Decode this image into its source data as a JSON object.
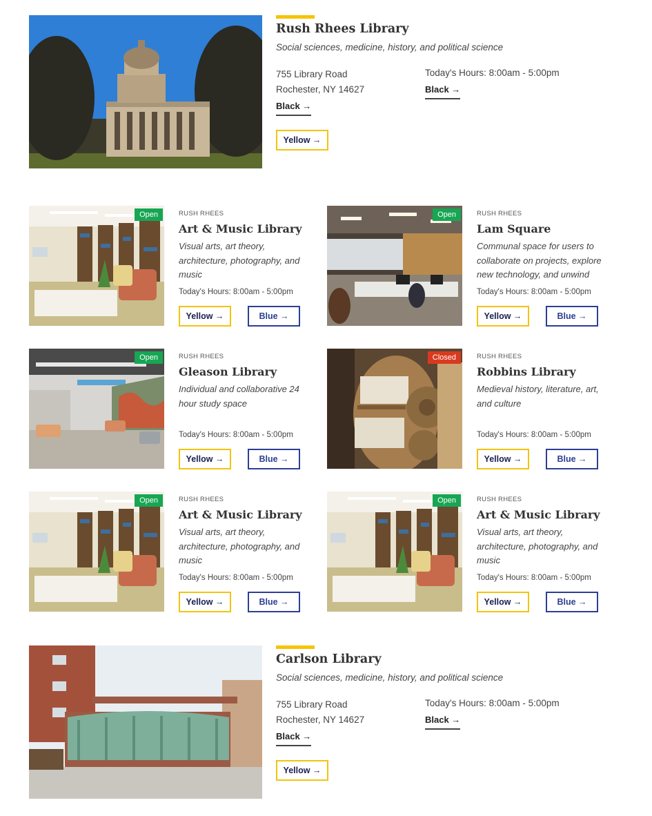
{
  "featured": [
    {
      "title": "Rush Rhees Library",
      "subtitle": "Social sciences, medicine, history, and political science",
      "address_line1": "755 Library Road",
      "address_line2": "Rochester, NY 14627",
      "hours": "Today's Hours: 8:00am - 5:00pm",
      "link1": "Black →",
      "link2": "Black →",
      "button": "Yellow →",
      "image": "rush-rhees-building-photo"
    },
    {
      "title": "Carlson Library",
      "subtitle": "Social sciences, medicine, history, and political science",
      "address_line1": "755 Library Road",
      "address_line2": "Rochester, NY 14627",
      "hours": "Today's Hours: 8:00am - 5:00pm",
      "link1": "Black →",
      "link2": "Black →",
      "button": "Yellow →",
      "image": "carlson-building-photo"
    }
  ],
  "cards": [
    {
      "eyebrow": "RUSH RHEES",
      "title": "Art & Music Library",
      "description": "Visual arts, art theory, architecture, photography, and music",
      "hours": "Today's Hours: 8:00am - 5:00pm",
      "status": "Open",
      "yellow": "Yellow →",
      "blue": "Blue →",
      "image": "library-lounge-photo"
    },
    {
      "eyebrow": "RUSH RHEES",
      "title": "Lam Square",
      "description": "Communal space for users to collaborate on projects, explore new technology, and unwind",
      "hours": "Today's Hours: 8:00am - 5:00pm",
      "status": "Open",
      "yellow": "Yellow →",
      "blue": "Blue →",
      "image": "lam-square-photo"
    },
    {
      "eyebrow": "RUSH RHEES",
      "title": "Gleason Library",
      "description": "Individual and collaborative 24 hour study space",
      "hours": "Today's Hours: 8:00am - 5:00pm",
      "status": "Open",
      "yellow": "Yellow →",
      "blue": "Blue →",
      "image": "gleason-study-space-photo"
    },
    {
      "eyebrow": "RUSH RHEES",
      "title": "Robbins Library",
      "description": "Medieval history, literature, art, and culture",
      "hours": "Today's Hours: 8:00am - 5:00pm",
      "status": "Closed",
      "yellow": "Yellow →",
      "blue": "Blue →",
      "image": "robbins-wheel-shelf-photo"
    },
    {
      "eyebrow": "RUSH RHEES",
      "title": "Art & Music Library",
      "description": "Visual arts, art theory, architecture, photography, and music",
      "hours": "Today's Hours: 8:00am - 5:00pm",
      "status": "Open",
      "yellow": "Yellow →",
      "blue": "Blue →",
      "image": "library-lounge-photo"
    },
    {
      "eyebrow": "RUSH RHEES",
      "title": "Art & Music Library",
      "description": "Visual arts, art theory, architecture, photography, and music",
      "hours": "Today's Hours: 8:00am - 5:00pm",
      "status": "Open",
      "yellow": "Yellow →",
      "blue": "Blue →",
      "image": "library-lounge-photo"
    }
  ],
  "colors": {
    "accent_yellow": "#f5c400",
    "button_yellow_border": "#f1c40f",
    "button_blue": "#2b3f94",
    "status_open": "#17a653",
    "status_closed": "#d93a1f"
  }
}
